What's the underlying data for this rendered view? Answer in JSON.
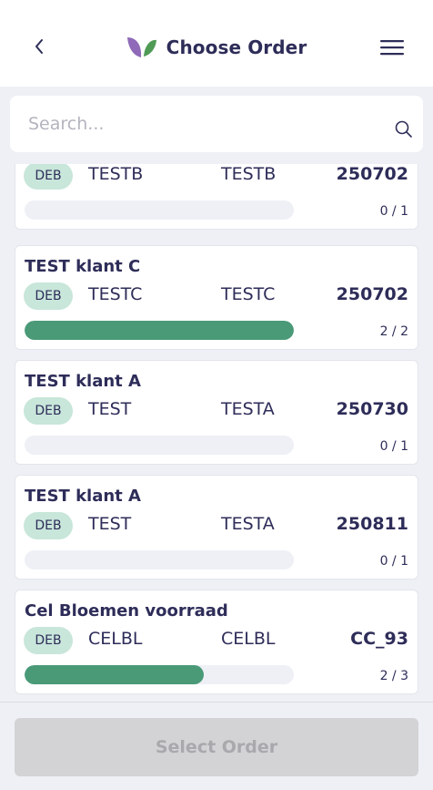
{
  "header": {
    "title": "Choose Order"
  },
  "search": {
    "placeholder": "Search...",
    "value": ""
  },
  "orders": [
    {
      "name": "",
      "badge": "DEB",
      "code1": "TESTB",
      "code2": "TESTB",
      "order_no": "250702",
      "count_text": "0 / 1",
      "progress": 0.0
    },
    {
      "name": "TEST klant C",
      "badge": "DEB",
      "code1": "TESTC",
      "code2": "TESTC",
      "order_no": "250702",
      "count_text": "2 / 2",
      "progress": 1.0
    },
    {
      "name": "TEST klant A",
      "badge": "DEB",
      "code1": "TEST",
      "code2": "TESTA",
      "order_no": "250730",
      "count_text": "0 / 1",
      "progress": 0.0
    },
    {
      "name": "TEST klant A",
      "badge": "DEB",
      "code1": "TEST",
      "code2": "TESTA",
      "order_no": "250811",
      "count_text": "0 / 1",
      "progress": 0.0
    },
    {
      "name": "Cel Bloemen voorraad",
      "badge": "DEB",
      "code1": "CELBL",
      "code2": "CELBL",
      "order_no": "CC_93",
      "count_text": "2 / 3",
      "progress": 0.667
    }
  ],
  "footer": {
    "select_label": "Select Order"
  },
  "colors": {
    "brand_navy": "#2e2d59",
    "progress_green": "#4a9a78",
    "badge_green": "#c8e6da",
    "logo_purple": "#8e6ab8",
    "logo_green": "#4f9a55"
  }
}
